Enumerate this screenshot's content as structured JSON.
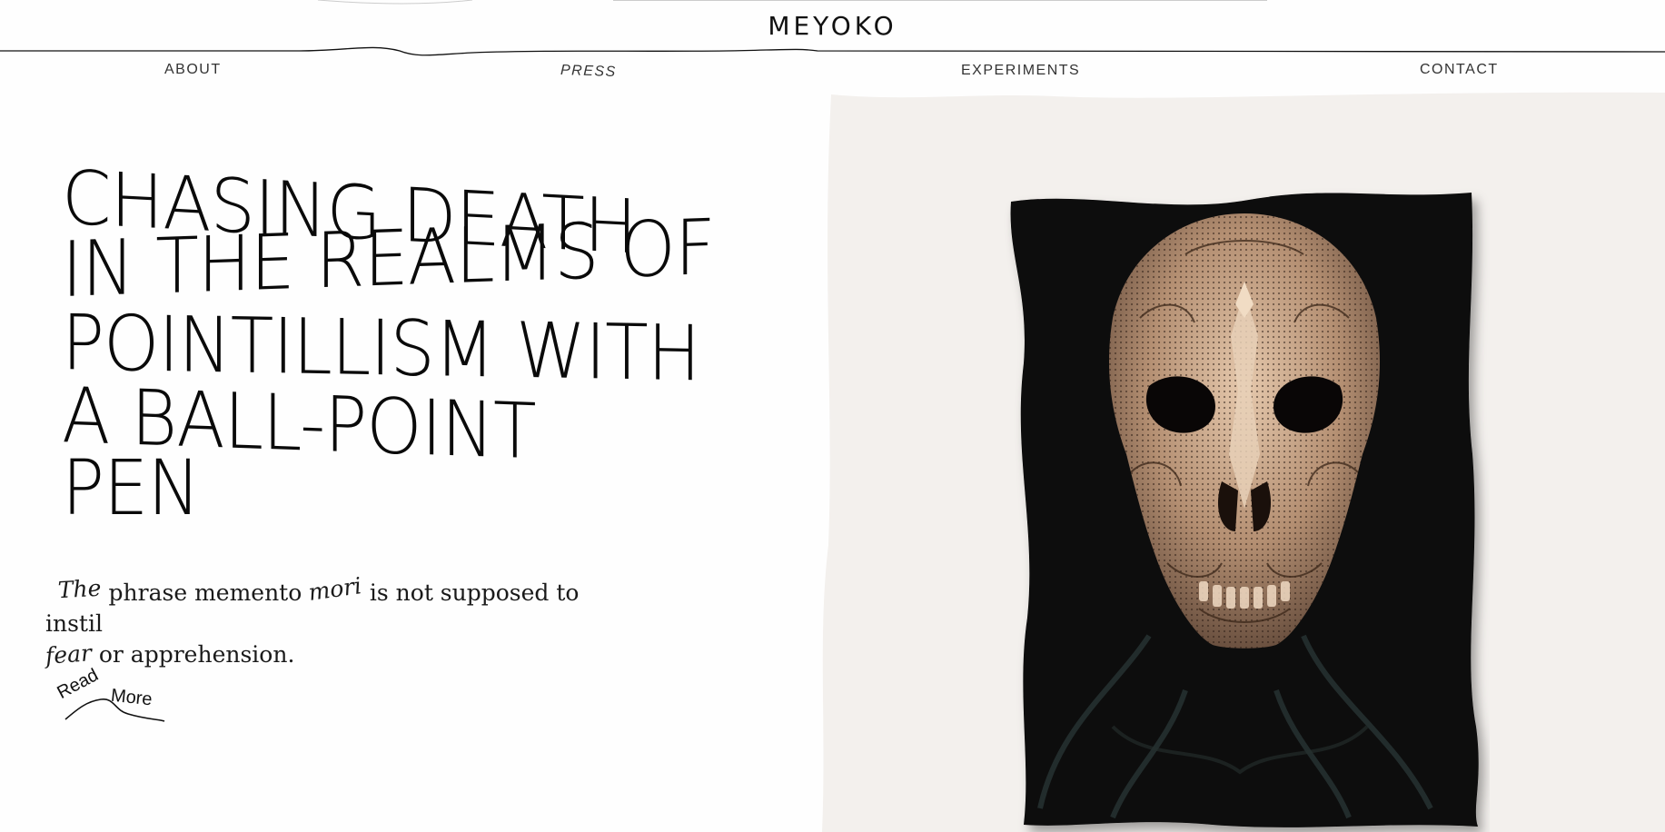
{
  "header": {
    "brand": "MEYOKO",
    "nav": [
      {
        "label": "ABOUT"
      },
      {
        "label": "PRESS"
      },
      {
        "label": "EXPERIMENTS"
      },
      {
        "label": "CONTACT"
      }
    ]
  },
  "hero": {
    "headline_lines": [
      "CHASING DEATH",
      "IN THE REALMS OF",
      "POINTILLISM WITH",
      "A BALL-POINT",
      "PEN"
    ],
    "intro": {
      "w1": "The",
      "w2": "phrase memento",
      "w3": "mori",
      "w4": "is not supposed to instil",
      "w5": "fear",
      "w6": "or apprehension."
    },
    "read_more": {
      "word1": "Read",
      "word2": "More"
    }
  },
  "colors": {
    "page_bg": "#fefefe",
    "panel_bg": "#f3f0ed",
    "artwork_bg": "#070707",
    "ink": "#0a0a0a",
    "skull": "#c9a88a"
  },
  "icons": {
    "artwork": "skull-illustration"
  }
}
